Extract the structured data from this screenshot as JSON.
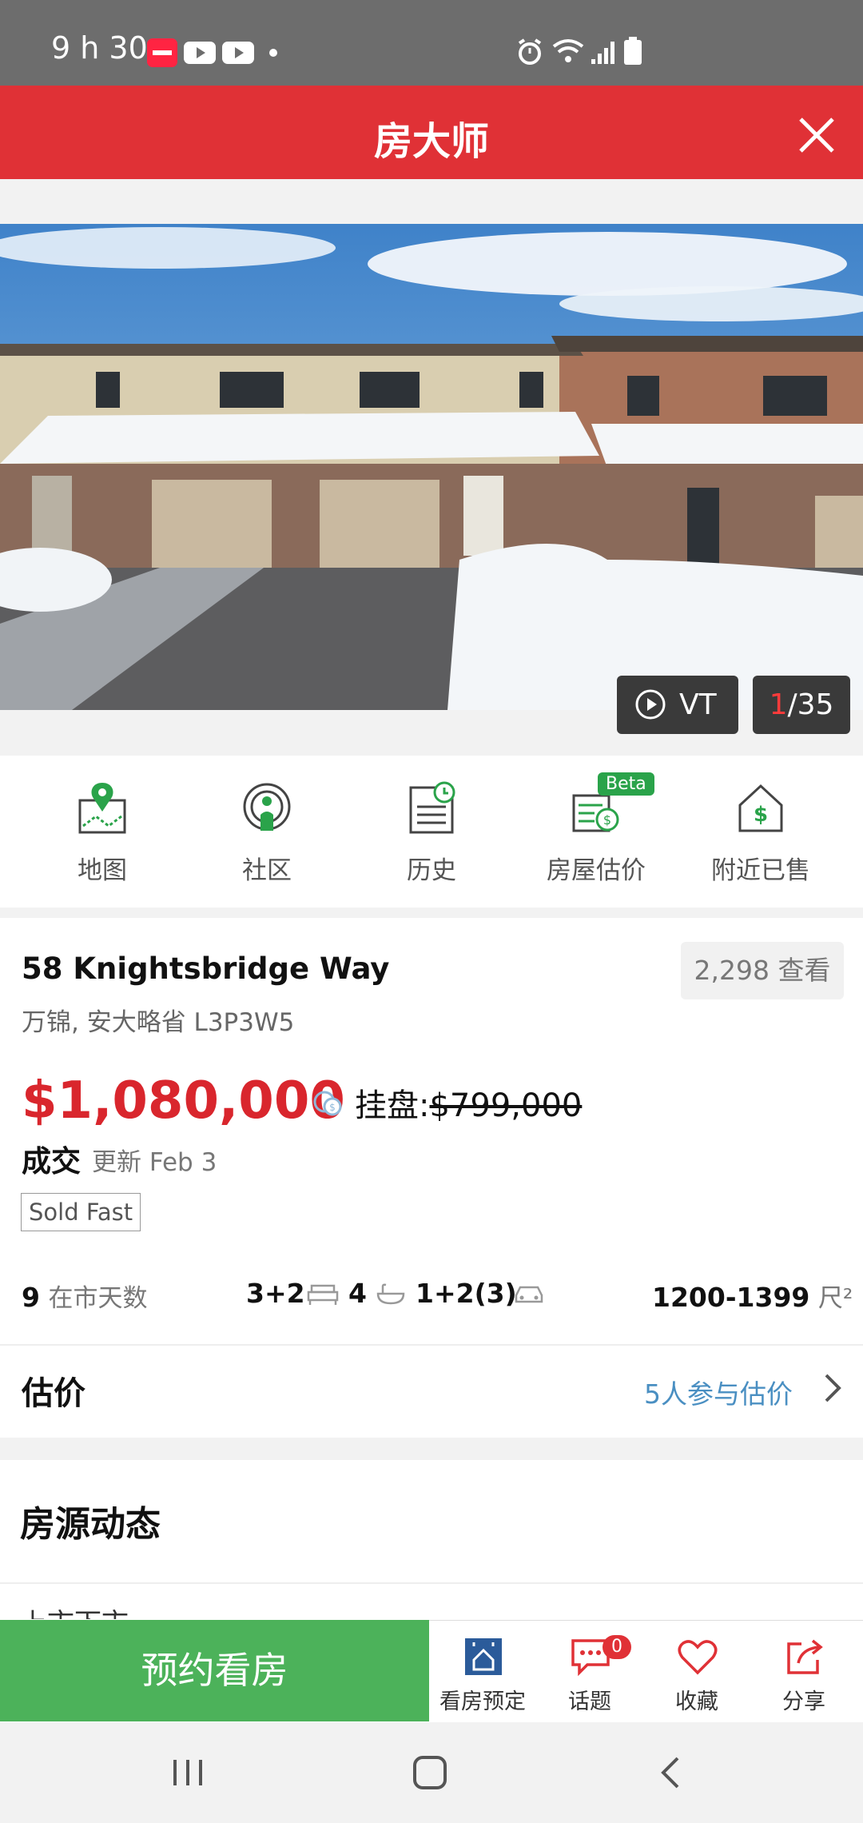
{
  "status_bar": {
    "time": "9 h 30"
  },
  "header": {
    "title": "房大师"
  },
  "photo": {
    "vt_label": "VT",
    "index": "1",
    "total": "/35"
  },
  "quick_actions": [
    {
      "label": "地图",
      "icon": "map-pin-icon"
    },
    {
      "label": "社区",
      "icon": "community-icon"
    },
    {
      "label": "历史",
      "icon": "history-icon"
    },
    {
      "label": "房屋估价",
      "icon": "valuation-icon",
      "badge": "Beta"
    },
    {
      "label": "附近已售",
      "icon": "nearby-sold-icon"
    }
  ],
  "listing": {
    "address": "58 Knightsbridge Way",
    "city_line": "万锦, 安大略省 L3P3W5",
    "views": "2,298 查看",
    "sold_price": "$1,080,000",
    "list_label": "挂盘:",
    "list_price": "$799,000",
    "status": "成交",
    "updated": "更新 Feb 3",
    "tag": "Sold Fast",
    "days_on_market": "9",
    "days_label": "在市天数",
    "bedrooms": "3+2",
    "bathrooms": "4",
    "parking": "1+2(3)",
    "size": "1200-1399",
    "size_unit": "尺²"
  },
  "estimate": {
    "label": "估价",
    "link": "5人参与估价"
  },
  "dynamics": {
    "title": "房源动态",
    "cut_text": "上市下市"
  },
  "bottom_bar": {
    "book_label": "预约看房",
    "items": [
      {
        "label": "看房预定",
        "icon": "calendar-home-icon"
      },
      {
        "label": "话题",
        "icon": "chat-icon",
        "badge": "0"
      },
      {
        "label": "收藏",
        "icon": "heart-icon"
      },
      {
        "label": "分享",
        "icon": "share-icon"
      }
    ]
  },
  "colors": {
    "brand_red": "#e03136",
    "action_green": "#4cb25a",
    "icon_green": "#2aa34a",
    "link_blue": "#4a8fc2"
  }
}
